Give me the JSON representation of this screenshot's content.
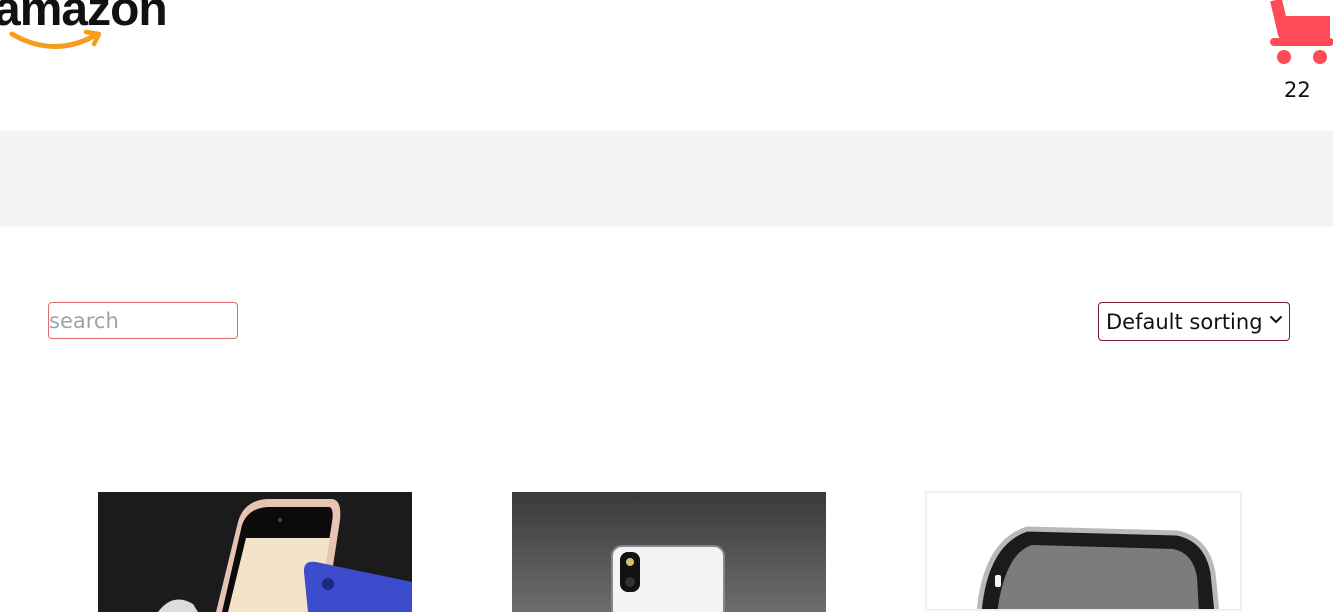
{
  "header": {
    "logo_text": "amazon",
    "cart_icon": "cart-icon",
    "cart_count": "22",
    "brand_color": "#ff4a57",
    "logo_smile_color": "#f79c1c"
  },
  "toolbar": {
    "search_placeholder": "search",
    "sort_selected": "Default sorting",
    "search_border_color": "#e16b75",
    "sort_border_color": "#7a1f2b"
  },
  "products": [
    {
      "image": "phone-image-rose-and-blue"
    },
    {
      "image": "phone-image-silver-back"
    },
    {
      "image": "phone-image-dark-rounded"
    }
  ]
}
